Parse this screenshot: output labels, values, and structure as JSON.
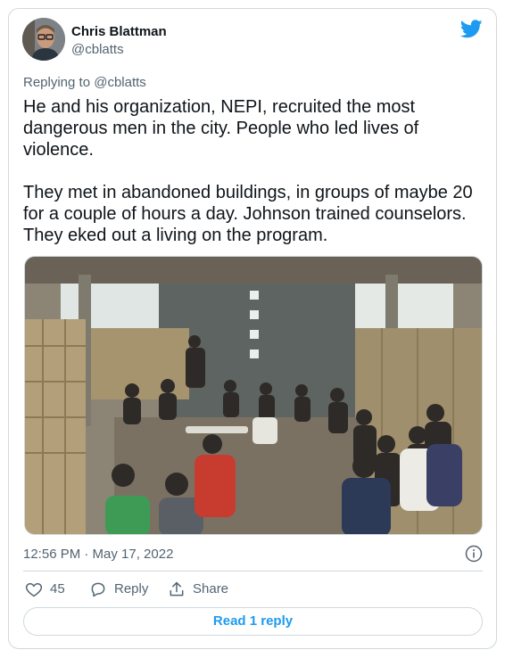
{
  "author": {
    "name": "Chris Blattman",
    "handle": "@cblatts",
    "avatar": "profile-photo",
    "logo": "twitter-bird-icon"
  },
  "tweet": {
    "replying_to": "Replying to @cblatts",
    "paragraphs": [
      "He and his organization, NEPI, recruited the most dangerous men in the city. People who led lives of violence.",
      "They met in abandoned buildings, in groups of maybe 20 for a couple of hours a day. Johnson trained counselors. They eked out a living on the program."
    ],
    "media": "photo-group-meeting-in-abandoned-building",
    "timestamp": "12:56 PM · May 17, 2022"
  },
  "actions": {
    "like_count": "45",
    "reply_label": "Reply",
    "share_label": "Share"
  },
  "read_reply_label": "Read 1 reply",
  "colors": {
    "accent": "#1d9bf0",
    "text": "#0f1419",
    "secondary": "#536471",
    "border": "#cfd9de"
  }
}
